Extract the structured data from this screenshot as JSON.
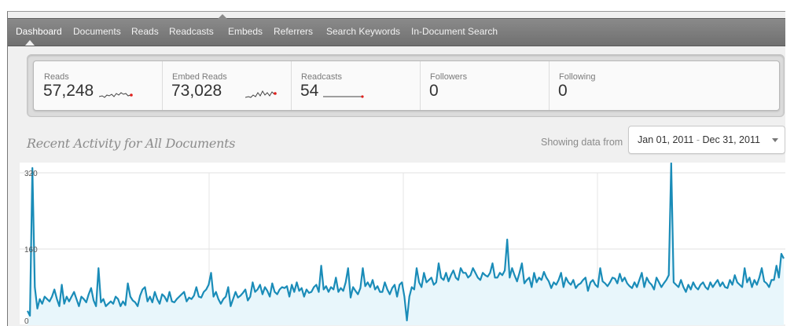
{
  "nav": {
    "tabs": [
      "Dashboard",
      "Documents",
      "Reads",
      "Readcasts",
      "Embeds",
      "Referrers",
      "Search Keywords",
      "In-Document Search"
    ],
    "active_tab": "Dashboard"
  },
  "stats": [
    {
      "label": "Reads",
      "value": "57,248",
      "sparkline": true
    },
    {
      "label": "Embed Reads",
      "value": "73,028",
      "sparkline": true
    },
    {
      "label": "Readcasts",
      "value": "54",
      "sparkline": true
    },
    {
      "label": "Followers",
      "value": "0",
      "sparkline": false
    },
    {
      "label": "Following",
      "value": "0",
      "sparkline": false
    }
  ],
  "section_title": "Recent Activity for All Documents",
  "date_filter": {
    "prefix": "Showing data from",
    "start": "Jan 01, 2011",
    "separator": "-",
    "end": "Dec 31, 2011"
  },
  "colors": {
    "line": "#1a8cb8",
    "area": "#e8f6fb",
    "spark": "#444444",
    "spark_dot": "#e0201c",
    "nav_bg": "#7a7a7a"
  },
  "icons": {
    "dropdown": "chevron-down-icon"
  },
  "chart_data": {
    "type": "area",
    "title": "",
    "xlabel": "",
    "ylabel": "",
    "y_ticks": [
      0,
      160,
      320
    ],
    "ylim": [
      0,
      320
    ],
    "x_range": [
      "2011-01-01",
      "2011-12-31"
    ],
    "x_ticks": [
      "",
      "",
      ""
    ],
    "series": [
      {
        "name": "",
        "values": [
          30,
          20,
          330,
          80,
          35,
          55,
          45,
          60,
          55,
          50,
          60,
          75,
          55,
          40,
          85,
          45,
          60,
          50,
          60,
          70,
          55,
          40,
          60,
          55,
          48,
          65,
          78,
          52,
          40,
          120,
          48,
          55,
          40,
          45,
          50,
          45,
          60,
          55,
          40,
          50,
          42,
          88,
          60,
          52,
          48,
          40,
          62,
          75,
          80,
          50,
          60,
          48,
          70,
          55,
          45,
          65,
          60,
          50,
          70,
          50,
          48,
          55,
          60,
          65,
          70,
          50,
          58,
          55,
          62,
          80,
          60,
          58,
          70,
          75,
          85,
          110,
          60,
          70,
          55,
          45,
          55,
          60,
          80,
          40,
          55,
          70,
          58,
          62,
          68,
          75,
          52,
          60,
          90,
          70,
          75,
          85,
          65,
          80,
          72,
          60,
          88,
          70,
          65,
          75,
          80,
          78,
          82,
          60,
          85,
          70,
          90,
          72,
          78,
          60,
          75,
          68,
          70,
          80,
          85,
          70,
          125,
          75,
          82,
          70,
          80,
          75,
          100,
          70,
          78,
          72,
          90,
          120,
          58,
          80,
          72,
          65,
          78,
          120,
          82,
          90,
          80,
          95,
          75,
          82,
          70,
          70,
          90,
          75,
          65,
          78,
          85,
          60,
          85,
          90,
          60,
          10,
          60,
          80,
          75,
          120,
          90,
          80,
          110,
          90,
          95,
          100,
          85,
          90,
          130,
          100,
          95,
          110,
          92,
          105,
          115,
          100,
          95,
          120,
          110,
          110,
          100,
          105,
          120,
          110,
          100,
          95,
          110,
          105,
          102,
          110,
          130,
          100,
          100,
          110,
          105,
          115,
          180,
          100,
          120,
          105,
          92,
          110,
          130,
          88,
          95,
          100,
          80,
          110,
          90,
          100,
          95,
          112,
          100,
          92,
          78,
          90,
          85,
          95,
          110,
          80,
          100,
          90,
          85,
          95,
          78,
          85,
          88,
          95,
          100,
          72,
          90,
          95,
          85,
          80,
          120,
          92,
          88,
          82,
          90,
          100,
          98,
          88,
          108,
          92,
          100,
          88,
          82,
          78,
          90,
          80,
          95,
          110,
          80,
          100,
          90,
          85,
          75,
          100,
          90,
          80,
          88,
          95,
          105,
          340,
          90,
          85,
          80,
          95,
          80,
          70,
          85,
          75,
          90,
          80,
          75,
          85,
          90,
          80,
          75,
          90,
          80,
          88,
          95,
          82,
          90,
          80,
          78,
          95,
          85,
          105,
          90,
          85,
          80,
          120,
          90,
          100,
          80,
          95,
          85,
          100,
          120,
          92,
          88,
          80,
          95,
          95,
          125,
          100,
          150,
          140
        ]
      }
    ]
  }
}
